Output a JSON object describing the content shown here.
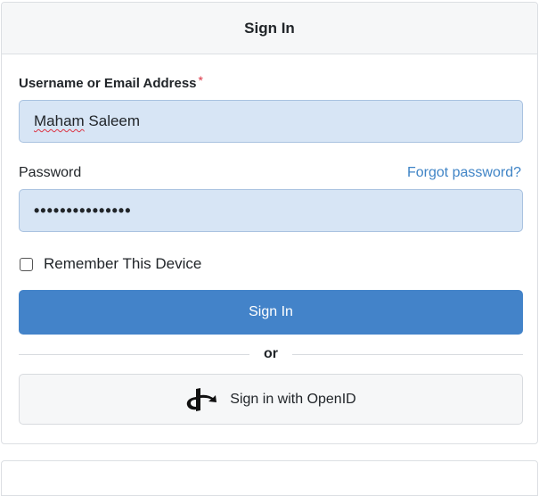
{
  "header": {
    "title": "Sign In"
  },
  "form": {
    "username_label": "Username or Email Address",
    "required_marker": "*",
    "username_value_first": "Maham",
    "username_value_rest": " Saleem",
    "password_label": "Password",
    "forgot_password_link": "Forgot password?",
    "password_value": "•••••••••••••••",
    "remember_label": "Remember This Device",
    "remember_checked": false,
    "signin_button": "Sign In",
    "divider_text": "or",
    "openid_button": "Sign in with OpenID"
  },
  "icons": {
    "openid": "openid-icon"
  },
  "colors": {
    "primary": "#4383c9",
    "link": "#3f84c6",
    "required": "#dc3545",
    "input_bg": "#d7e5f5"
  }
}
